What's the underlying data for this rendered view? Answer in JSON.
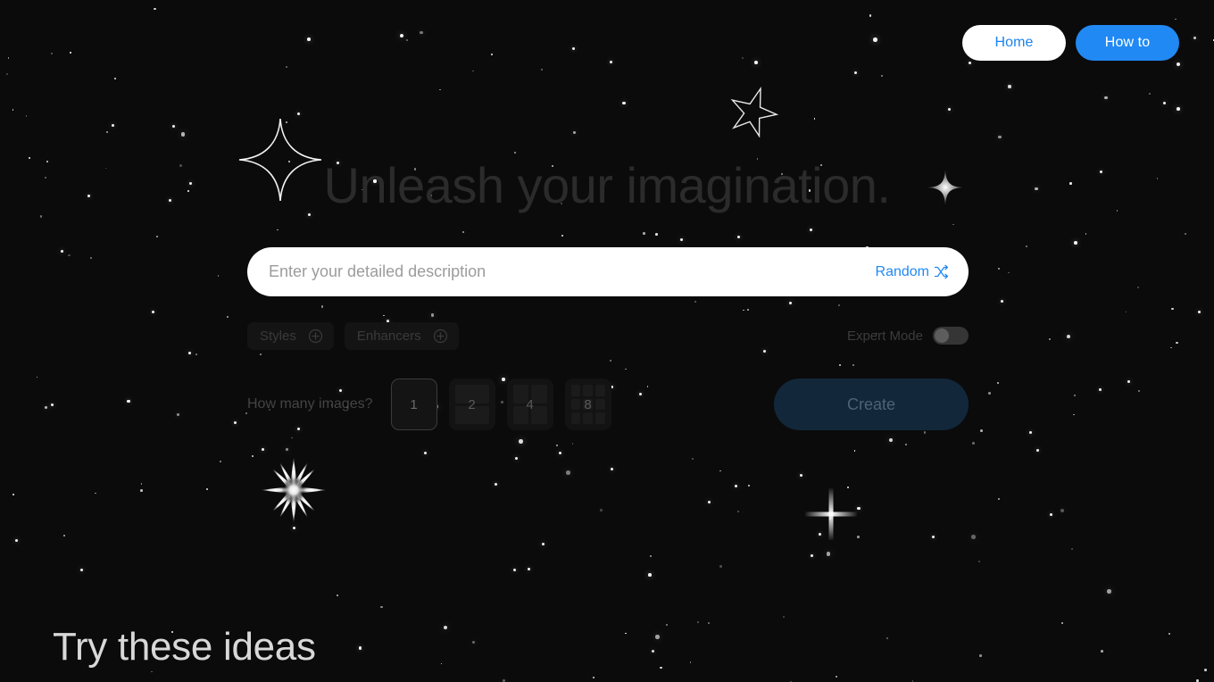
{
  "nav": {
    "home_label": "Home",
    "howto_label": "How to"
  },
  "hero": {
    "title": "Unleash your imagination."
  },
  "prompt": {
    "placeholder": "Enter your detailed description",
    "value": "",
    "random_label": "Random",
    "random_icon": "shuffle-icon"
  },
  "options": {
    "styles_label": "Styles",
    "styles_icon": "plus-circle-icon",
    "enhancers_label": "Enhancers",
    "enhancers_icon": "plus-circle-icon",
    "expert_mode_label": "Expert Mode",
    "expert_mode_on": false
  },
  "count": {
    "label": "How many images?",
    "selected": "1",
    "options": [
      {
        "value": "1",
        "cols": 1,
        "rows": 1,
        "cells": 1
      },
      {
        "value": "2",
        "cols": 1,
        "rows": 2,
        "cells": 2
      },
      {
        "value": "4",
        "cols": 2,
        "rows": 2,
        "cells": 4
      },
      {
        "value": "8",
        "cols": 3,
        "rows": 3,
        "cells": 9
      }
    ]
  },
  "actions": {
    "create_label": "Create"
  },
  "ideas": {
    "title": "Try these ideas"
  },
  "colors": {
    "background": "#0b0b0b",
    "accent_blue": "#2189f3",
    "home_button_bg": "#ffffff",
    "home_button_text": "#1a84f0",
    "create_button_bg": "#13273a",
    "create_button_text": "#4e6277",
    "hero_title": "#2b2b2b",
    "ideas_title": "#d8d8d8"
  },
  "decor": {
    "sparkle_outline_large": "sparkle-outline-icon",
    "star_outline": "star-outline-icon",
    "sparkle_filled_small": "sparkle-filled-icon",
    "starburst": "starburst-icon",
    "cross_sparkle": "cross-sparkle-icon"
  }
}
